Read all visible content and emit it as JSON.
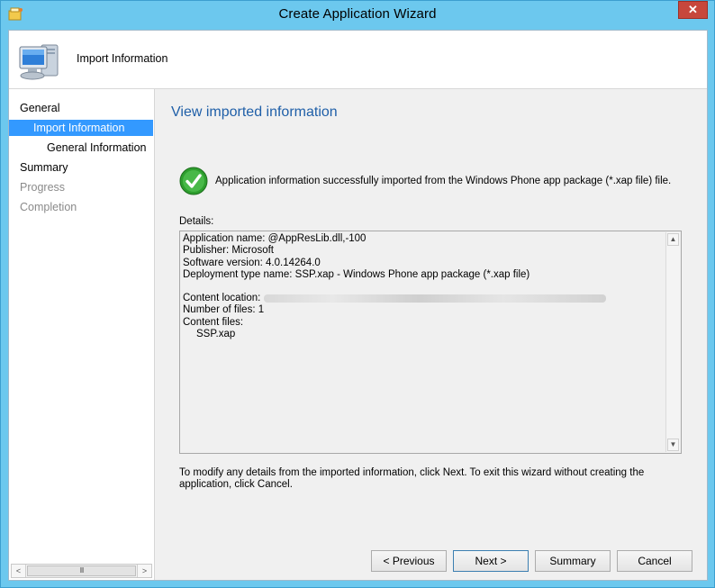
{
  "window": {
    "title": "Create Application Wizard",
    "close_glyph": "✕",
    "icon": "wizard-app-icon"
  },
  "header": {
    "title": "Import Information",
    "icon": "computer-icon"
  },
  "nav": {
    "items": [
      {
        "label": "General",
        "state": "normal"
      },
      {
        "label": "Import Information",
        "state": "selected"
      },
      {
        "label": "General Information",
        "state": "normal"
      },
      {
        "label": "Summary",
        "state": "normal"
      },
      {
        "label": "Progress",
        "state": "disabled"
      },
      {
        "label": "Completion",
        "state": "disabled"
      }
    ],
    "scroll_left": "<",
    "scroll_right": ">",
    "scroll_thumb": "III"
  },
  "content": {
    "heading": "View imported information",
    "success_message": "Application information successfully imported from the Windows Phone app package (*.xap file) file.",
    "details_label": "Details:",
    "details": {
      "app_name": "Application name: @AppResLib.dll,-100",
      "publisher": "Publisher: Microsoft",
      "software_version": "Software version: 4.0.14264.0",
      "deployment_type": "Deployment type name: SSP.xap - Windows Phone app package (*.xap file)",
      "content_location_label": "Content location:",
      "number_of_files": "Number of files: 1",
      "content_files_label": "Content files:",
      "content_file": "SSP.xap"
    },
    "footer_note": "To modify any details from the imported information, click Next. To exit this wizard without creating the application, click Cancel."
  },
  "buttons": {
    "previous": "< Previous",
    "next": "Next >",
    "summary": "Summary",
    "cancel": "Cancel"
  },
  "colors": {
    "window_frame": "#6cc8ee",
    "heading": "#1f5fa8",
    "nav_selected": "#3399ff",
    "close_button": "#c7473c",
    "success": "#2e9e2e"
  }
}
